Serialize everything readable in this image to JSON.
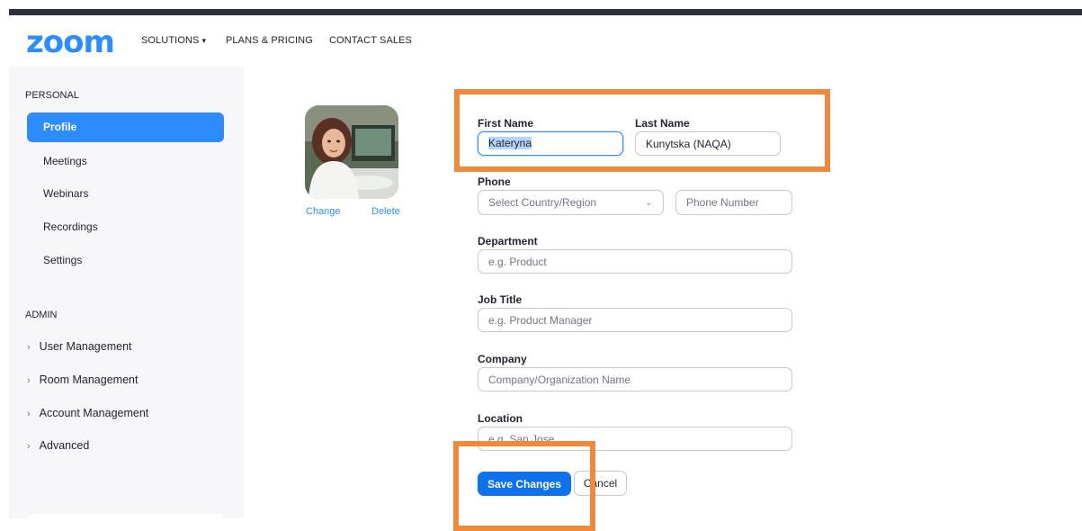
{
  "header": {
    "logo": "zoom",
    "nav": {
      "solutions": "SOLUTIONS",
      "plans": "PLANS & PRICING",
      "contact": "CONTACT SALES"
    }
  },
  "sidebar": {
    "personal_heading": "PERSONAL",
    "personal_items": [
      "Profile",
      "Meetings",
      "Webinars",
      "Recordings",
      "Settings"
    ],
    "active_item": "Profile",
    "admin_heading": "ADMIN",
    "admin_items": [
      "User Management",
      "Room Management",
      "Account Management",
      "Advanced"
    ]
  },
  "photo": {
    "change_label": "Change",
    "delete_label": "Delete"
  },
  "form": {
    "first_name": {
      "label": "First Name",
      "value": "Kateryna"
    },
    "last_name": {
      "label": "Last Name",
      "value": "Kunytska (NAQA)"
    },
    "phone": {
      "label": "Phone",
      "country_placeholder": "Select Country/Region",
      "number_placeholder": "Phone Number"
    },
    "department": {
      "label": "Department",
      "placeholder": "e.g. Product"
    },
    "job_title": {
      "label": "Job Title",
      "placeholder": "e.g. Product Manager"
    },
    "company": {
      "label": "Company",
      "placeholder": "Company/Organization Name"
    },
    "location": {
      "label": "Location",
      "placeholder": "e.g. San Jose"
    }
  },
  "buttons": {
    "save": "Save Changes",
    "cancel": "Cancel"
  },
  "colors": {
    "accent": "#2d8cff",
    "primary_button": "#0e72ed",
    "annotation": "#f08a3a",
    "sidebar_bg": "#f7f7fa"
  }
}
